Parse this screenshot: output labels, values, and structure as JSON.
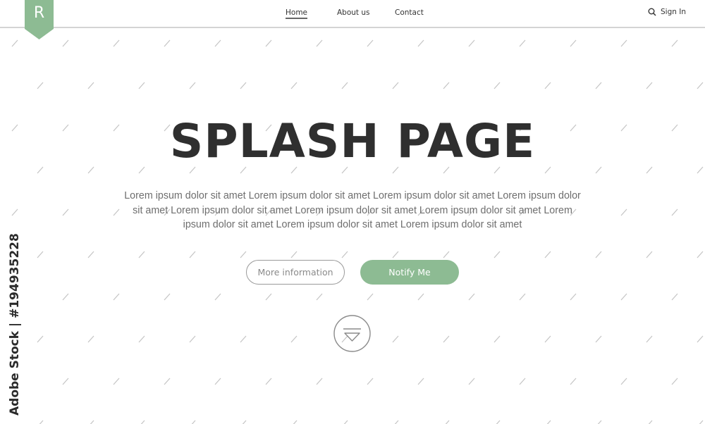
{
  "header": {
    "logo_letter": "R",
    "nav": [
      {
        "label": "Home",
        "active": true
      },
      {
        "label": "About us",
        "active": false
      },
      {
        "label": "Contact",
        "active": false
      }
    ],
    "search_icon": "search-icon",
    "signin_label": "Sign In"
  },
  "hero": {
    "title": "SPLASH PAGE",
    "body": "Lorem ipsum dolor sit amet Lorem ipsum dolor sit amet Lorem ipsum dolor sit amet Lorem ipsum dolor sit amet Lorem ipsum dolor sit amet Lorem ipsum dolor sit amet Lorem ipsum dolor sit amet Lorem ipsum dolor sit amet Lorem ipsum dolor sit amet Lorem ipsum dolor sit amet",
    "more_button": "More information",
    "notify_button": "Notify Me",
    "scroll_icon": "scroll-down-icon"
  },
  "watermark": {
    "stock_label": "Adobe Stock | #194935228"
  },
  "colors": {
    "accent": "#8dbb93",
    "title": "#2f2f2f",
    "text": "#6e6e6e",
    "pattern": "#c8c8c8"
  }
}
